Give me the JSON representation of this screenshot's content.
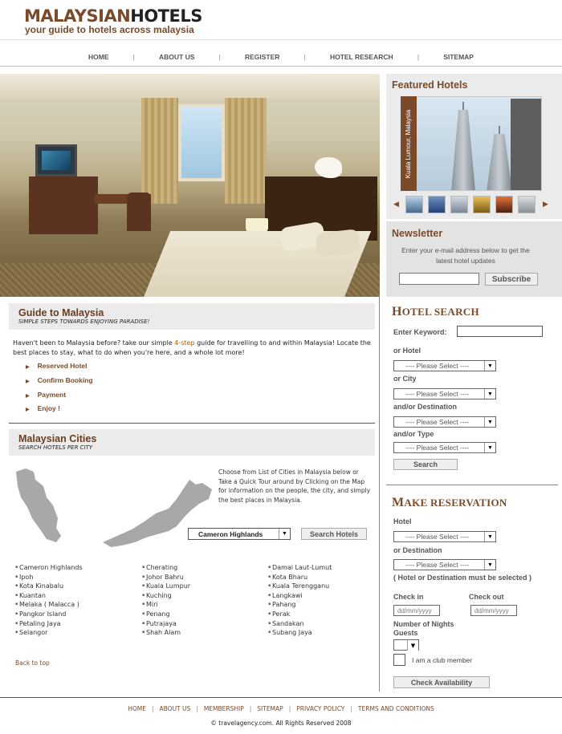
{
  "header": {
    "logo_part1": "MALAYSIAN",
    "logo_part2": "HOTELS",
    "tagline": "your guide to hotels across malaysia"
  },
  "nav": {
    "items": [
      "HOME",
      "ABOUT US",
      "REGISTER",
      "HOTEL RESEARCH",
      "SITEMAP"
    ],
    "separator": "|"
  },
  "featured": {
    "title": "Featured Hotels",
    "caption": "Kuala Lumour, Malaysia",
    "prev_icon": "◀",
    "next_icon": "▶"
  },
  "newsletter": {
    "title": "Newsletter",
    "text": "Enter your e-mail address below to get the latest hotel updates",
    "subscribe_label": "Subscribe"
  },
  "guide": {
    "title": "Guide to Malaysia",
    "subtitle": "SIMPLE STEPS TOWARDS ENJOYING PARADISE!",
    "intro_before": "Haven't been to Malaysia before? take our simple ",
    "intro_highlight": "4-step",
    "intro_after": " guide for travelling to and within Malaysia! Locate the best places to stay, what to do when you're here, and a whole lot more!",
    "steps": [
      "Reserved Hotel",
      "Confirm Booking",
      "Payment",
      "Enjoy !"
    ]
  },
  "cities": {
    "title": "Malaysian Cities",
    "subtitle": "SEARCH HOTELS PER CITY",
    "map_text": "Choose from List of Cities in Malaysia below or Take a Quick Tour  around by Clicking on the Map for information on  the people, the city, and simply the best places in Malaysia.",
    "selected_city": "Cameron Highlands",
    "search_label": "Search Hotels",
    "col1": [
      "Cameron Highlands",
      "Ipoh",
      "Kota Kinabalu",
      "Kuantan",
      "Melaka ( Malacca )",
      "Pangkor Island",
      "Petaling Jaya",
      "Selangor"
    ],
    "col2": [
      "Cherating",
      "Johor Bahru",
      "Kuala Lumpur",
      "Kuching",
      "Miri",
      "Penang",
      "Putrajaya",
      "Shah Alam"
    ],
    "col3": [
      "Damai Laut-Lumut",
      "Kota Bharu",
      "Kuala Terengganu",
      "Langkawi",
      "Pahang",
      "Perak",
      "Sandakan",
      "Subang Jaya"
    ],
    "back_to_top": "Back to top"
  },
  "hotel_search": {
    "title_cap": "H",
    "title_rest": "OTEL SEARCH",
    "keyword_label": "Enter Keyword:",
    "hotel_label": "or Hotel",
    "city_label": "or City",
    "destination_label": "and/or Destination",
    "type_label": "and/or Type",
    "select_placeholder": "---- Please Select ----",
    "search_label": "Search"
  },
  "reservation": {
    "title_cap": "M",
    "title_rest": "AKE RESERVATION",
    "hotel_label": "Hotel",
    "destination_label": "or Destination",
    "select_placeholder": "---- Please Select ----",
    "note": "( Hotel or Destination must be selected )",
    "checkin_label": "Check in",
    "checkout_label": "Check out",
    "date_placeholder": "dd/mm/yyyy",
    "nights_label": "Number of Nights",
    "guests_label": "Guests",
    "club_label": "I am a club member",
    "submit_label": "Check Availability"
  },
  "footer": {
    "links": [
      "HOME",
      "ABOUT US",
      "MEMBERSHIP",
      "SITEMAP",
      "PRIVACY POLICY",
      "TERMS AND CONDITIONS"
    ],
    "separator": "|",
    "copyright": "© travelagency.com. All Rights Reserved 2008"
  },
  "colors": {
    "brand_brown": "#7a4a2a",
    "panel_gray": "#ebebeb",
    "map_gray": "#a8a8a8"
  }
}
